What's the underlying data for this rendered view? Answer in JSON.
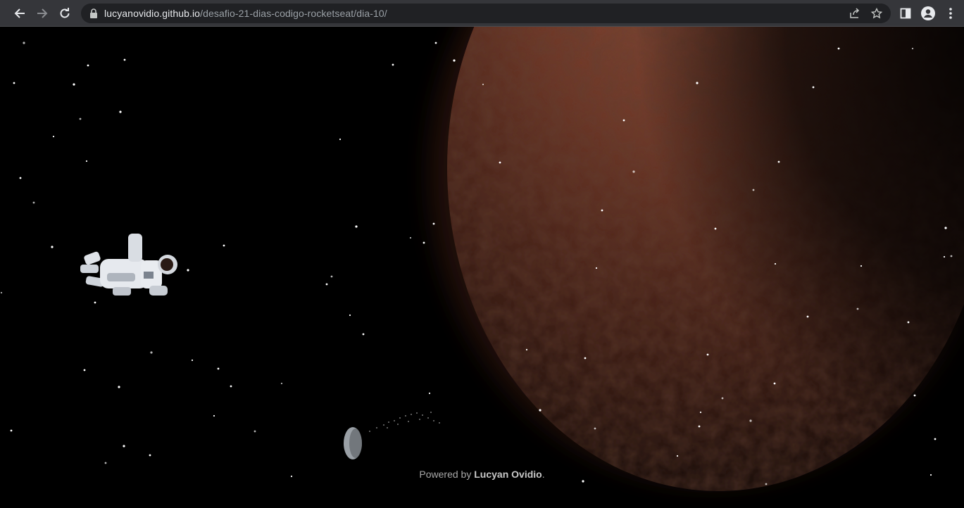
{
  "browser": {
    "url_host": "lucyanovidio.github.io",
    "url_path": "/desafio-21-dias-codigo-rocketseat/dia-10/",
    "icons": {
      "back": "arrow-left-icon",
      "forward": "arrow-right-icon",
      "reload": "reload-icon",
      "lock": "lock-icon",
      "share": "share-icon",
      "bookmark": "star-icon",
      "side_panel": "side-panel-icon",
      "profile": "profile-icon",
      "menu": "kebab-menu-icon"
    }
  },
  "page": {
    "footer_prefix": "Powered by ",
    "footer_author": "Lucyan Ovidio",
    "footer_suffix": ".",
    "colors": {
      "background": "#000000",
      "planet": "#7a3e2c",
      "planet_glow": "#5a2a1e"
    }
  }
}
